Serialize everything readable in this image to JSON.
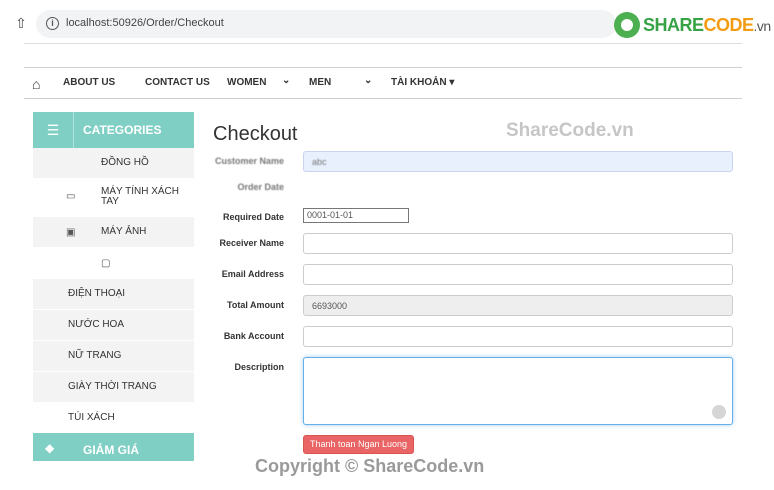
{
  "browser": {
    "url": "localhost:50926/Order/Checkout",
    "home_icon": "home-icon",
    "info_icon": "info-icon"
  },
  "logo": {
    "share": "SHARE",
    "code": "CODE",
    "vn": ".vn"
  },
  "nav": {
    "items": [
      "ABOUT US",
      "CONTACT US",
      "WOMEN",
      "MEN",
      "TÀI KHOẢN ▾"
    ]
  },
  "sidebar": {
    "header": "CATEGORIES",
    "items": [
      "ĐỒNG HỒ",
      "MÁY TÍNH XÁCH TAY",
      "MÁY ẢNH",
      "",
      "ĐIỆN THOẠI",
      "NƯỚC HOA",
      "NỮ TRANG",
      "GIÀY THỜI TRANG",
      "TÚI XÁCH"
    ],
    "discount": "GIẢM GIÁ"
  },
  "form": {
    "title": "Checkout",
    "labels": {
      "customer_name": "Customer Name",
      "order_date": "Order Date",
      "required_date": "Required Date",
      "receiver_name": "Receiver Name",
      "email": "Email Address",
      "total": "Total Amount",
      "bank": "Bank Account",
      "description": "Description"
    },
    "values": {
      "customer_name": "abc",
      "order_date": "",
      "required_date": "0001-01-01",
      "receiver_name": "",
      "email": "",
      "total": "6693000",
      "bank": ""
    },
    "submit": "Thanh toan Ngan Luong"
  },
  "watermark": "ShareCode.vn",
  "copyright": "Copyright © ShareCode.vn",
  "colors": {
    "accent": "#7fcfc4",
    "button": "#e96464",
    "focus": "#66afe9"
  }
}
